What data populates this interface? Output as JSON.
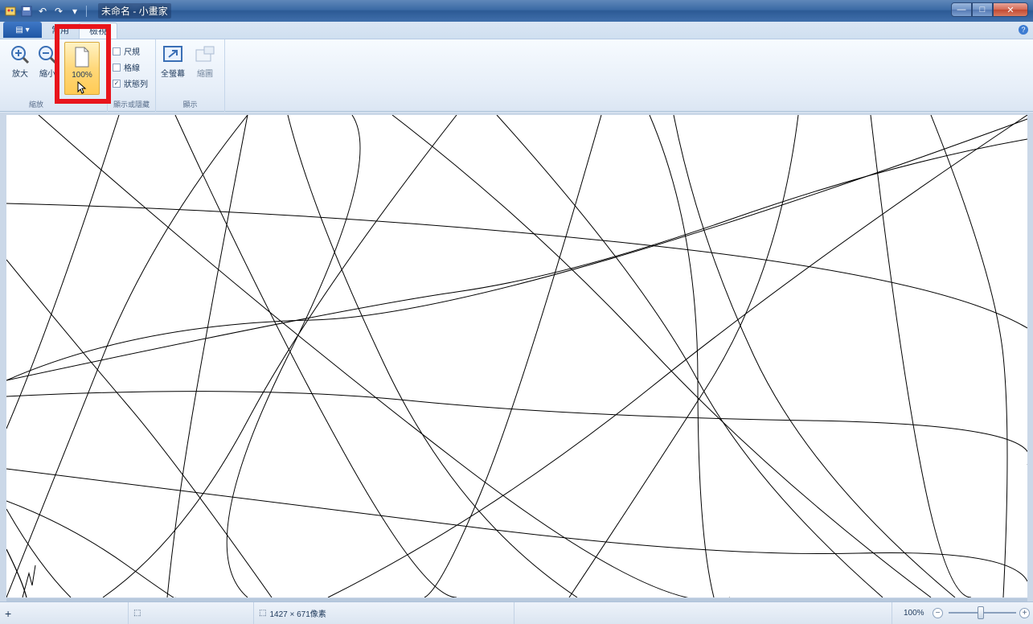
{
  "window": {
    "title": "未命名 - 小畫家"
  },
  "titlebar": {
    "minimize": "—",
    "maximize": "□",
    "close": "✕"
  },
  "tabs": [
    {
      "label": "常用"
    },
    {
      "label": "檢視"
    }
  ],
  "appmenu_label": "▤ ▾",
  "ribbon": {
    "zoom_group": {
      "label": "縮放",
      "zoom_in": "放大",
      "zoom_out": "縮小",
      "hundred": "100%"
    },
    "show_group": {
      "label": "顯示或隱藏",
      "rulers": "尺規",
      "gridlines": "格線",
      "statusbar": "狀態列"
    },
    "display_group": {
      "label": "顯示",
      "fullscreen": "全螢幕",
      "thumbnail": "縮圖"
    }
  },
  "status": {
    "add_icon": "+",
    "selection_icon": "⬚",
    "size_icon": "⬚",
    "image_size": "1427 × 671像素",
    "zoom": "100%",
    "zoom_out": "−",
    "zoom_in": "+"
  }
}
